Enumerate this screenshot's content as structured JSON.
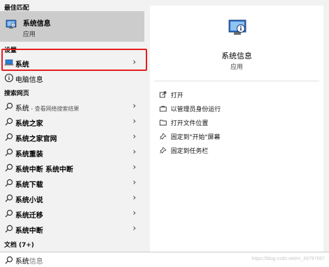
{
  "best_match": {
    "heading": "最佳匹配",
    "title": "系统信息",
    "subtitle": "应用"
  },
  "settings": {
    "heading": "设置",
    "items": [
      {
        "label": "系统"
      },
      {
        "label": "电脑信息"
      }
    ]
  },
  "web": {
    "heading": "搜索网页",
    "items": [
      {
        "label": "系统",
        "sub": " - 查看网络搜索结果"
      },
      {
        "label": "系统之家"
      },
      {
        "label": "系统之家官网"
      },
      {
        "label": "系统重装"
      },
      {
        "label": "系统中断 系统中断"
      },
      {
        "label": "系统下载"
      },
      {
        "label": "系统小说"
      },
      {
        "label": "系统迁移"
      },
      {
        "label": "系统中断"
      }
    ]
  },
  "docs": {
    "heading": "文档 (7+)"
  },
  "detail": {
    "title": "系统信息",
    "subtitle": "应用",
    "actions": [
      {
        "label": "打开",
        "icon": "open-icon"
      },
      {
        "label": "以管理员身份运行",
        "icon": "admin-icon"
      },
      {
        "label": "打开文件位置",
        "icon": "folder-icon"
      },
      {
        "label": "固定到\"开始\"屏幕",
        "icon": "pin-icon"
      },
      {
        "label": "固定到任务栏",
        "icon": "pin-icon"
      }
    ]
  },
  "search": {
    "typed": "系统",
    "suggest": "信息",
    "watermark": "https://blog.csdn.net/m_43797657"
  },
  "colors": {
    "highlight": "#e81d1d",
    "selected": "#cccccc"
  }
}
